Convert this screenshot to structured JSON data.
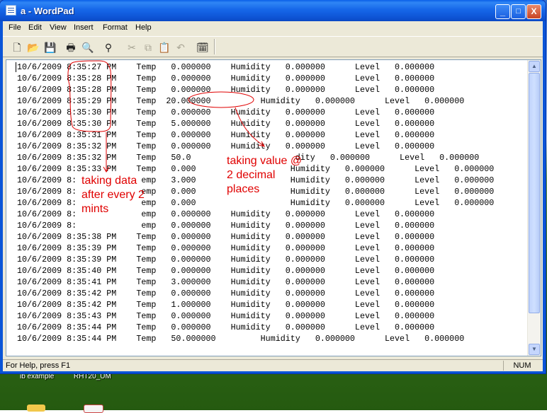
{
  "window": {
    "title": "a - WordPad"
  },
  "title_buttons": [
    "_",
    "□",
    "X"
  ],
  "menu": [
    "File",
    "Edit",
    "View",
    "Insert",
    "Format",
    "Help"
  ],
  "toolbar": {
    "icons": [
      "new-icon",
      "open-icon",
      "save-icon",
      "print-icon",
      "print-preview-icon",
      "find-icon",
      "cut-icon",
      "copy-icon",
      "paste-icon",
      "undo-icon",
      "date-time-icon"
    ]
  },
  "document": {
    "lines": [
      "10/6/2009 8:35:27 PM    Temp   0.000000    Humidity   0.000000      Level   0.000000",
      "10/6/2009 8:35:28 PM    Temp   0.000000    Humidity   0.000000      Level   0.000000",
      "10/6/2009 8:35:28 PM    Temp   0.000000    Humidity   0.000000      Level   0.000000",
      "10/6/2009 8:35:29 PM    Temp  20.000000          Humidity   0.000000      Level   0.000000",
      "10/6/2009 8:35:30 PM    Temp   0.000000    Humidity   0.000000      Level   0.000000",
      "10/6/2009 8:35:30 PM    Temp   5.000000    Humidity   0.000000      Level   0.000000",
      "10/6/2009 8:35:31 PM    Temp   0.000000    Humidity   0.000000      Level   0.000000",
      "10/6/2009 8:35:32 PM    Temp   0.000000    Humidity   0.000000      Level   0.000000",
      "10/6/2009 8:35:32 PM    Temp   50.0                     dity   0.000000      Level   0.000000",
      "10/6/2009 8:35:33 PM    Temp   0.000                   Humidity   0.000000      Level   0.000000",
      "10/6/2009 8:             emp   3.000                   Humidity   0.000000      Level   0.000000",
      "10/6/2009 8:             emp   0.000                   Humidity   0.000000      Level   0.000000",
      "10/6/2009 8:             emp   0.000                   Humidity   0.000000      Level   0.000000",
      "10/6/2009 8:             emp   0.000000    Humidity   0.000000      Level   0.000000",
      "10/6/2009 8:             emp   0.000000    Humidity   0.000000      Level   0.000000",
      "10/6/2009 8:35:38 PM    Temp   0.000000    Humidity   0.000000      Level   0.000000",
      "10/6/2009 8:35:39 PM    Temp   0.000000    Humidity   0.000000      Level   0.000000",
      "10/6/2009 8:35:39 PM    Temp   0.000000    Humidity   0.000000      Level   0.000000",
      "10/6/2009 8:35:40 PM    Temp   0.000000    Humidity   0.000000      Level   0.000000",
      "10/6/2009 8:35:41 PM    Temp   3.000000    Humidity   0.000000      Level   0.000000",
      "10/6/2009 8:35:42 PM    Temp   0.000000    Humidity   0.000000      Level   0.000000",
      "10/6/2009 8:35:42 PM    Temp   1.000000    Humidity   0.000000      Level   0.000000",
      "10/6/2009 8:35:43 PM    Temp   0.000000    Humidity   0.000000      Level   0.000000",
      "10/6/2009 8:35:44 PM    Temp   0.000000    Humidity   0.000000      Level   0.000000",
      "10/6/2009 8:35:44 PM    Temp   50.000000         Humidity   0.000000      Level   0.000000"
    ]
  },
  "annotations": {
    "taking_data": [
      "taking data",
      "after every 2",
      "mints"
    ],
    "taking_value": [
      "taking value @",
      "2 decimal",
      "places"
    ],
    "color": "#e00000"
  },
  "statusbar": {
    "help": "For Help, press F1",
    "num": "NUM"
  },
  "desktop": {
    "labels": [
      "ib example",
      "RHT20_UM"
    ]
  }
}
